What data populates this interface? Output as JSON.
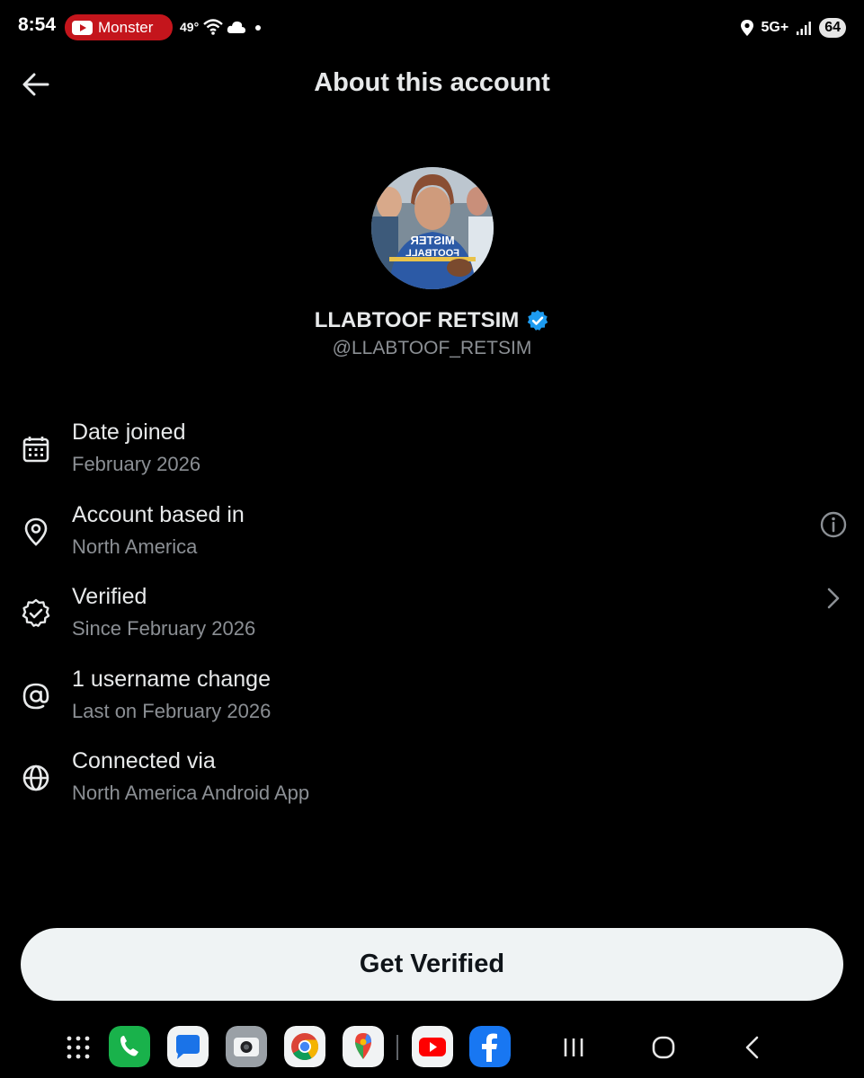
{
  "status_bar": {
    "time": "8:54",
    "notification_pill": "Monster",
    "temperature": "49°",
    "network": "5G+",
    "battery": "64"
  },
  "header": {
    "title": "About this account",
    "back_icon": "arrow-left-icon"
  },
  "profile": {
    "display_name": "LLABTOOF RETSIM",
    "handle": "@LLABTOOF_RETSIM",
    "avatar_jersey_line1": "MISTER",
    "avatar_jersey_line2": "FOOTBALL",
    "verified_color": "#1d9bf0"
  },
  "info_items": [
    {
      "icon": "calendar-icon",
      "title": "Date joined",
      "subtitle": "February 2026"
    },
    {
      "icon": "location-pin-icon",
      "title": "Account based in",
      "subtitle": "North America",
      "trailing_icon": "info-icon"
    },
    {
      "icon": "verified-check-icon",
      "title": "Verified",
      "subtitle": "Since February 2026",
      "trailing_icon": "chevron-right-icon"
    },
    {
      "icon": "at-sign-icon",
      "title": "1 username change",
      "subtitle": "Last on February 2026"
    },
    {
      "icon": "globe-icon",
      "title": "Connected via",
      "subtitle": "North America Android App"
    }
  ],
  "cta": {
    "label": "Get Verified",
    "background": "#eff3f4"
  },
  "dock": {
    "apps": [
      "app-drawer",
      "phone",
      "messages",
      "camera",
      "chrome",
      "maps",
      "youtube",
      "facebook"
    ],
    "nav": [
      "recents",
      "home",
      "back"
    ]
  }
}
